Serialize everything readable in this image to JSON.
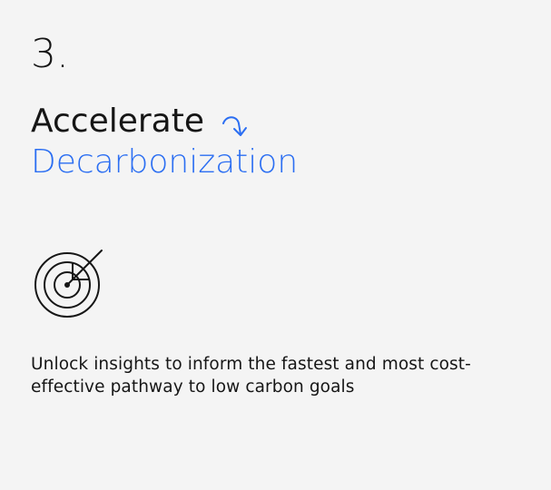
{
  "card": {
    "step_number": "3.",
    "heading_primary": "Accelerate",
    "heading_secondary": "Decarbonization",
    "description": "Unlock insights to inform the fastest and most cost-effective pathway to low carbon goals",
    "icons": {
      "heading_icon": "curved-arrow-icon",
      "illustration_icon": "target-icon"
    },
    "colors": {
      "accent": "#2b6ef2",
      "text": "#161616",
      "background": "#f4f4f4"
    }
  }
}
